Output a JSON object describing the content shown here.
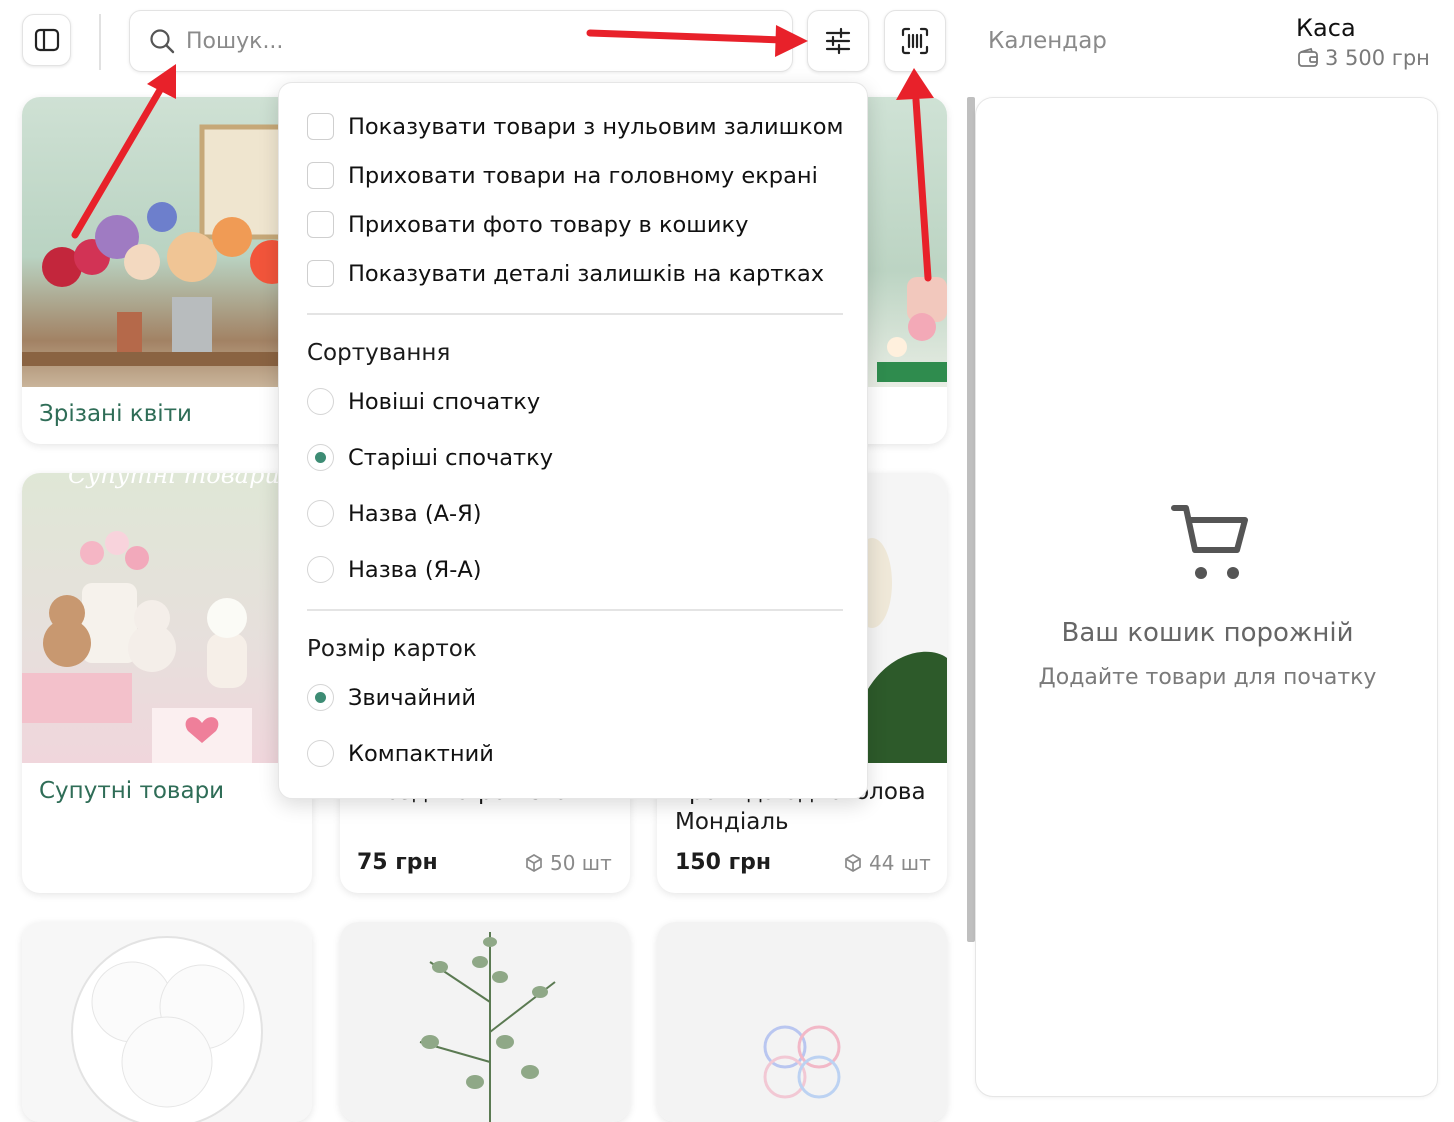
{
  "topbar": {
    "search_placeholder": "Пошук...",
    "calendar_label": "Календар",
    "register_title": "Каса",
    "register_balance": "3 500 грн"
  },
  "dropdown": {
    "options": [
      {
        "label": "Показувати товари з нульовим залишком",
        "checked": false
      },
      {
        "label": "Приховати товари на головному екрані",
        "checked": false
      },
      {
        "label": "Приховати фото товару в кошику",
        "checked": false
      },
      {
        "label": "Показувати деталі залишків на картках",
        "checked": false
      }
    ],
    "sort_title": "Сортування",
    "sort_options": [
      {
        "label": "Новіші спочатку",
        "selected": false
      },
      {
        "label": "Старіші спочатку",
        "selected": true
      },
      {
        "label": "Назва (А-Я)",
        "selected": false
      },
      {
        "label": "Назва (Я-А)",
        "selected": false
      }
    ],
    "size_title": "Розмір карток",
    "size_options": [
      {
        "label": "Звичайний",
        "selected": true
      },
      {
        "label": "Компактний",
        "selected": false
      }
    ]
  },
  "cards": {
    "cut_flowers": {
      "title": "Зрізані квіти"
    },
    "related_goods": {
      "title": "Супутні товари",
      "image_text": "Супутні товари"
    },
    "product_2": {
      "title_partial": "Гвоздика рожева",
      "price": "75 грн",
      "stock": "50 шт"
    },
    "product_3": {
      "title_line1": "Троянда одноголова",
      "title_line2": "Мондіаль",
      "price": "150 грн",
      "stock": "44 шт"
    }
  },
  "cart": {
    "empty_title": "Ваш кошик порожній",
    "empty_subtitle": "Додайте товари для початку"
  },
  "colors": {
    "accent": "#3d8c74",
    "annotation_arrow": "#e8212a"
  }
}
